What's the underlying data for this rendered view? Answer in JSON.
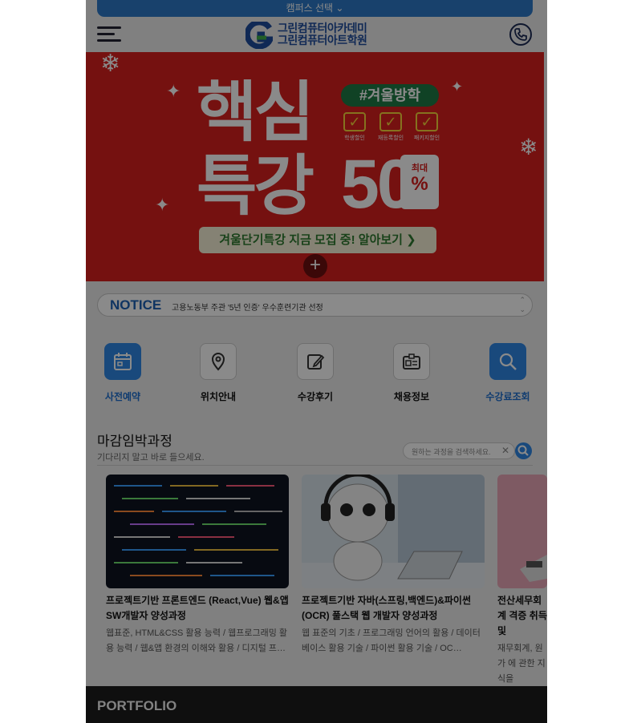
{
  "campus_selector": "캠퍼스 선택 ⌄",
  "logo": {
    "line1": "그린컴퓨터아카데미",
    "line2": "그린컴퓨터아트학원"
  },
  "banner": {
    "title_line1": "핵심",
    "title_line2": "특강",
    "hashtag": "#겨울방학",
    "check_labels": [
      "학생할인",
      "재등록할인",
      "패키지할인"
    ],
    "discount_number": "50",
    "discount_prefix": "최대",
    "discount_unit": "%",
    "cta": "겨울단기특강 지금 모집 중! 알아보기 ❯",
    "plus": "+"
  },
  "notice": {
    "label": "NOTICE",
    "text": "고용노동부 주관 '5년 인증' 우수훈련기관 선정"
  },
  "quick_menu": [
    {
      "label": "사전예약",
      "icon": "calendar-icon"
    },
    {
      "label": "위치안내",
      "icon": "location-pin-icon"
    },
    {
      "label": "수강후기",
      "icon": "edit-note-icon"
    },
    {
      "label": "채용정보",
      "icon": "id-card-icon"
    },
    {
      "label": "수강료조회",
      "icon": "search-icon"
    }
  ],
  "section": {
    "title": "마감임박과정",
    "subtitle": "기다리지 말고 바로 들으세요.",
    "search_placeholder": "원하는 과정을 검색하세요.",
    "clear": "✕"
  },
  "courses": [
    {
      "title": "프로젝트기반 프론트엔드 (React,Vue) 웹&앱 SW개발자 양성과정",
      "desc": "웹표준, HTML&CSS 활용 능력 / 웹프로그래밍 활용 능력 / 웹&앱 환경의 이해와 활용 / 디지털 프…"
    },
    {
      "title": "프로젝트기반 자바(스프링,백엔드)&파이썬 (OCR) 풀스택 웹 개발자 양성과정",
      "desc": "웹 표준의 기초 / 프로그래밍 언어의 활용 / 데이터베이스 활용 기술 / 파이썬 활용 기술 / OC…"
    },
    {
      "title": "전산세무회계 격증 취득 및",
      "desc": "재무회계, 원가 에 관한 지식을"
    }
  ],
  "portfolio": "PORTFOLIO",
  "colors": {
    "accent": "#2f87e6",
    "banner_red": "#d8201f",
    "notice_blue": "#1c61b5"
  }
}
